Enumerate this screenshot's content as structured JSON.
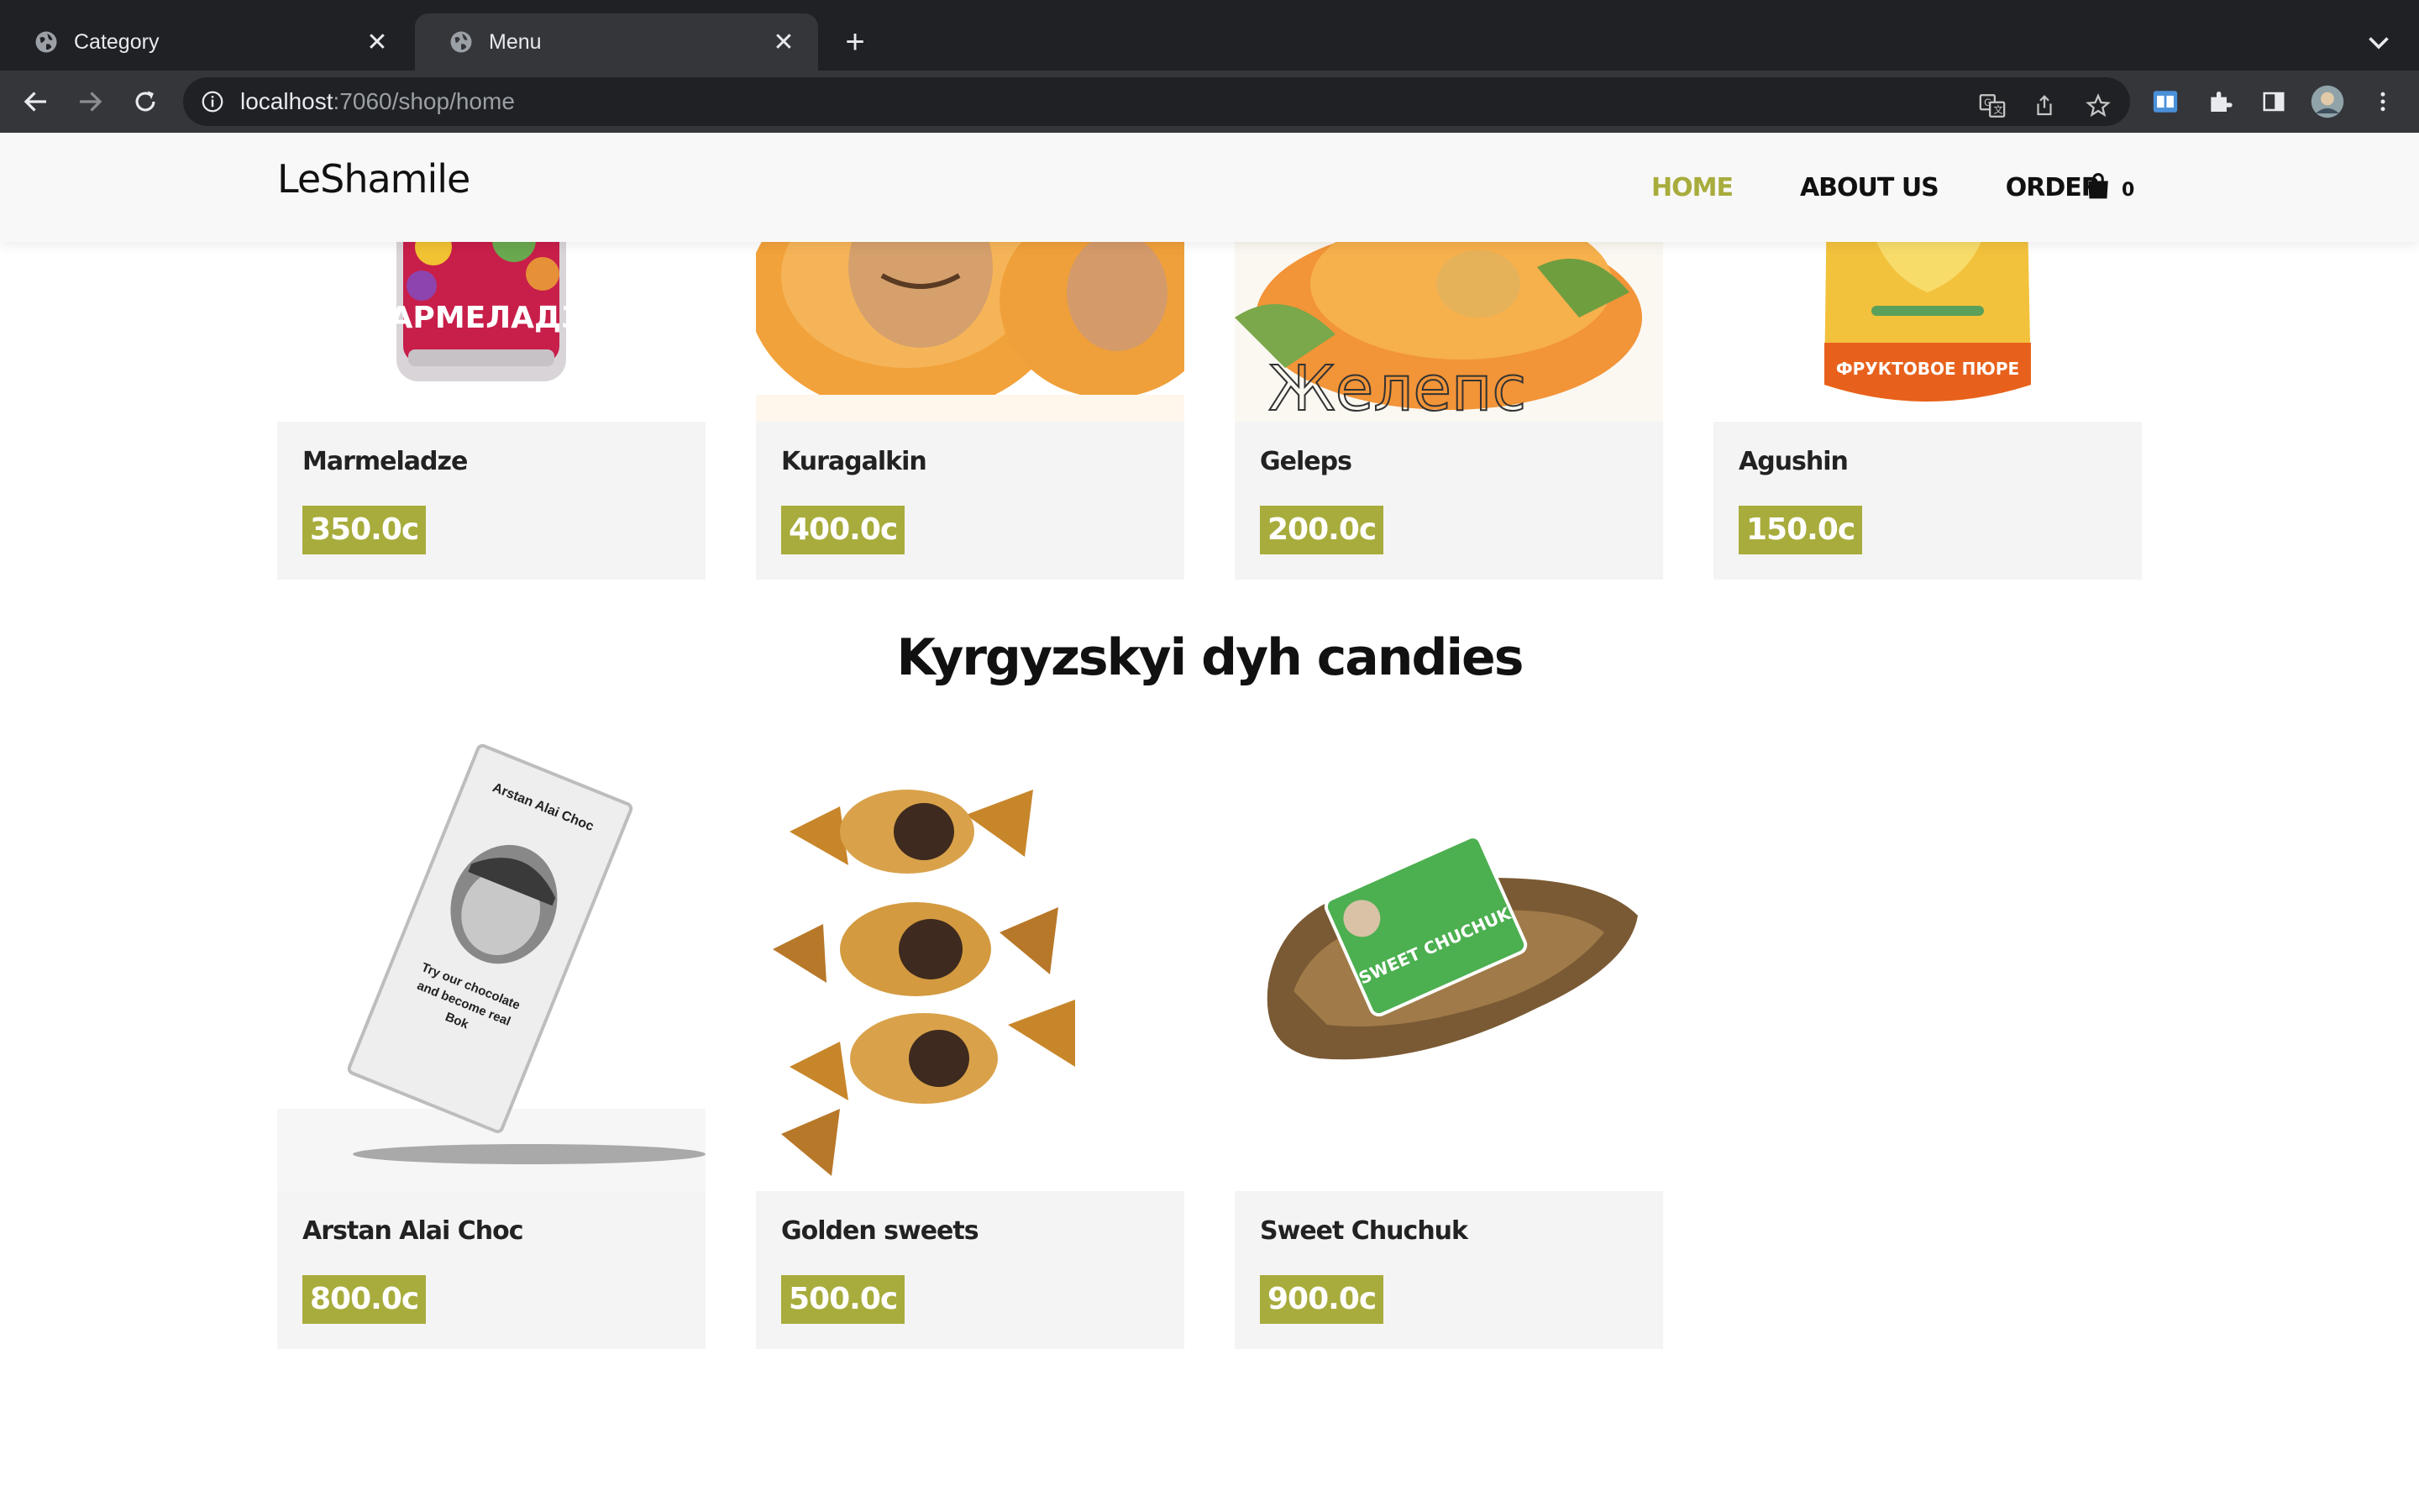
{
  "browser": {
    "tabs": [
      {
        "title": "Category",
        "active": false
      },
      {
        "title": "Menu",
        "active": true
      }
    ],
    "url_host": "localhost",
    "url_path": ":7060/shop/home"
  },
  "site": {
    "logo": "LeShamile",
    "nav": [
      {
        "label": "HOME",
        "active": true
      },
      {
        "label": "ABOUT US",
        "active": false
      },
      {
        "label": "ORDER",
        "active": false
      }
    ],
    "cart_count": "0",
    "accent_color": "#a8ac3c"
  },
  "products_top": [
    {
      "name": "Marmeladze",
      "price": "350.0c",
      "image_text": "МАРМЕЛАДЗЕ"
    },
    {
      "name": "Kuragalkin",
      "price": "400.0c"
    },
    {
      "name": "Geleps",
      "price": "200.0c",
      "image_text": "Желепс"
    },
    {
      "name": "Agushin",
      "price": "150.0c",
      "image_text": "ФРУКТОВОЕ ПЮРЕ"
    }
  ],
  "section": {
    "title": "Kyrgyzskyi dyh candies"
  },
  "products_bottom": [
    {
      "name": "Arstan Alai Choc",
      "price": "800.0c",
      "image_text": [
        "Arstan Alai Choc",
        "Try our chocolate",
        "and become real",
        "Bok"
      ]
    },
    {
      "name": "Golden sweets",
      "price": "500.0c"
    },
    {
      "name": "Sweet Chuchuk",
      "price": "900.0c",
      "image_text": "SWEET CHUCHUK"
    }
  ]
}
